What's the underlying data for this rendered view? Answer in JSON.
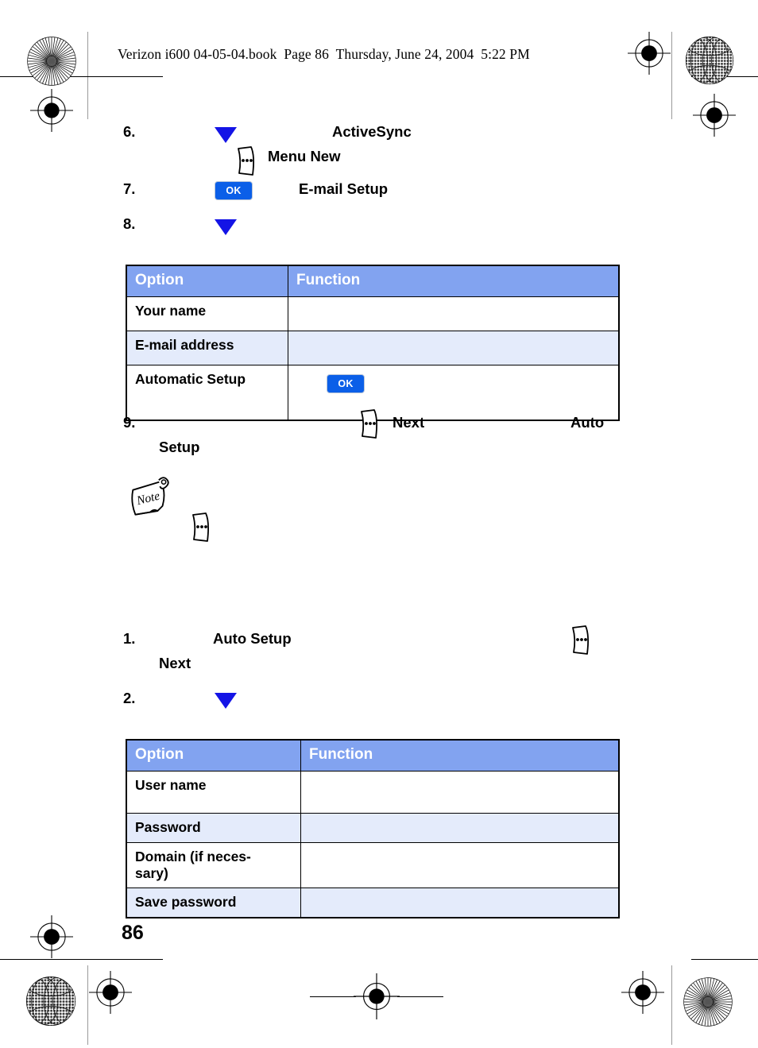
{
  "document": {
    "header_line": "Verizon i600 04-05-04.book  Page 86  Thursday, June 24, 2004  5:22 PM",
    "page_number": "86"
  },
  "colors": {
    "table_header_blue": "#82A3F0",
    "table_alt_row_blue": "#E4EBFB",
    "ok_button_blue": "#0B5FE8",
    "triangle_blue": "#1414E6",
    "crop_line_gray": "#9A9A9A",
    "text_black": "#000000"
  },
  "steps_upper": [
    {
      "number": "6.",
      "text": "ActiveSync",
      "sub_text": "Menu  New"
    },
    {
      "number": "7.",
      "text": "E-mail Setup"
    },
    {
      "number": "8.",
      "text": ""
    },
    {
      "number": "9.",
      "text_a": "Next",
      "text_b": "Auto",
      "text_c": "Setup"
    }
  ],
  "steps_lower": [
    {
      "number": "1.",
      "text": "Auto Setup",
      "sub_text": "Next"
    },
    {
      "number": "2.",
      "text": ""
    }
  ],
  "table_one": {
    "headers": [
      "Option",
      "Function"
    ],
    "rows": [
      {
        "option": "Your name",
        "function": ""
      },
      {
        "option": "E-mail address",
        "function": ""
      },
      {
        "option": "Automatic Setup",
        "function": "",
        "has_ok_icon": true
      }
    ]
  },
  "table_two": {
    "headers": [
      "Option",
      "Function"
    ],
    "rows": [
      {
        "option": "User name",
        "function": ""
      },
      {
        "option": "Password",
        "function": ""
      },
      {
        "option": "Domain (if neces-sary)",
        "function": ""
      },
      {
        "option": "Save password",
        "function": ""
      }
    ]
  },
  "icons": {
    "ok_label": "OK",
    "note_label": "Note",
    "softkey_name": "softkey-menu-icon",
    "down_triangle_name": "navigation-down-icon"
  }
}
